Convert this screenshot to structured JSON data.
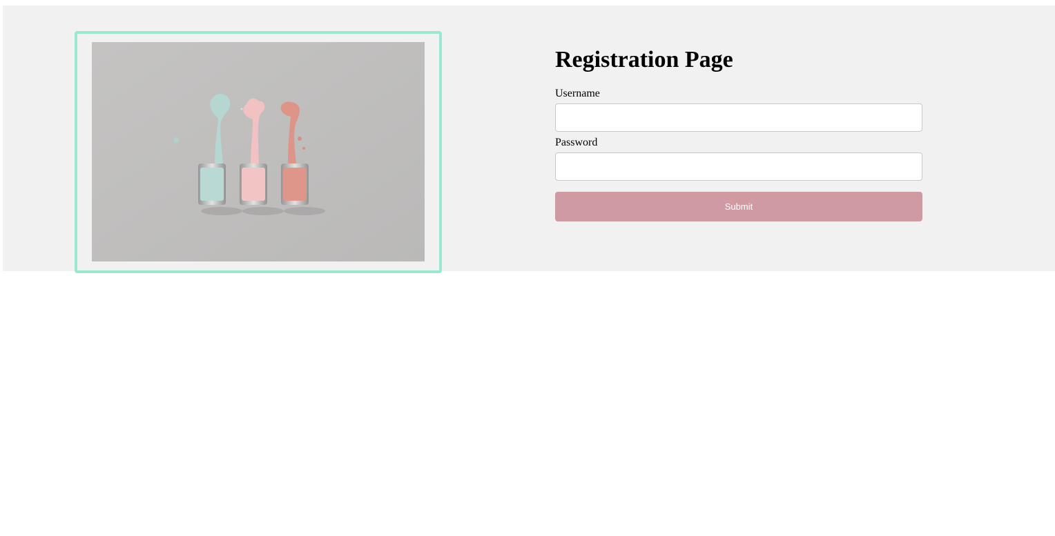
{
  "page": {
    "title": "Registration Page"
  },
  "image": {
    "icon": "nail-polish-bottles-photo",
    "frame_color": "#9be8d2",
    "background_color": "#bfbebd",
    "bottles": [
      {
        "color": "#b9d9d4"
      },
      {
        "color": "#f3c4c4"
      },
      {
        "color": "#de968b"
      }
    ]
  },
  "form": {
    "username_label": "Username",
    "username_value": "",
    "password_label": "Password",
    "password_value": "",
    "submit_label": "Submit",
    "submit_color": "#cf9aa2"
  }
}
